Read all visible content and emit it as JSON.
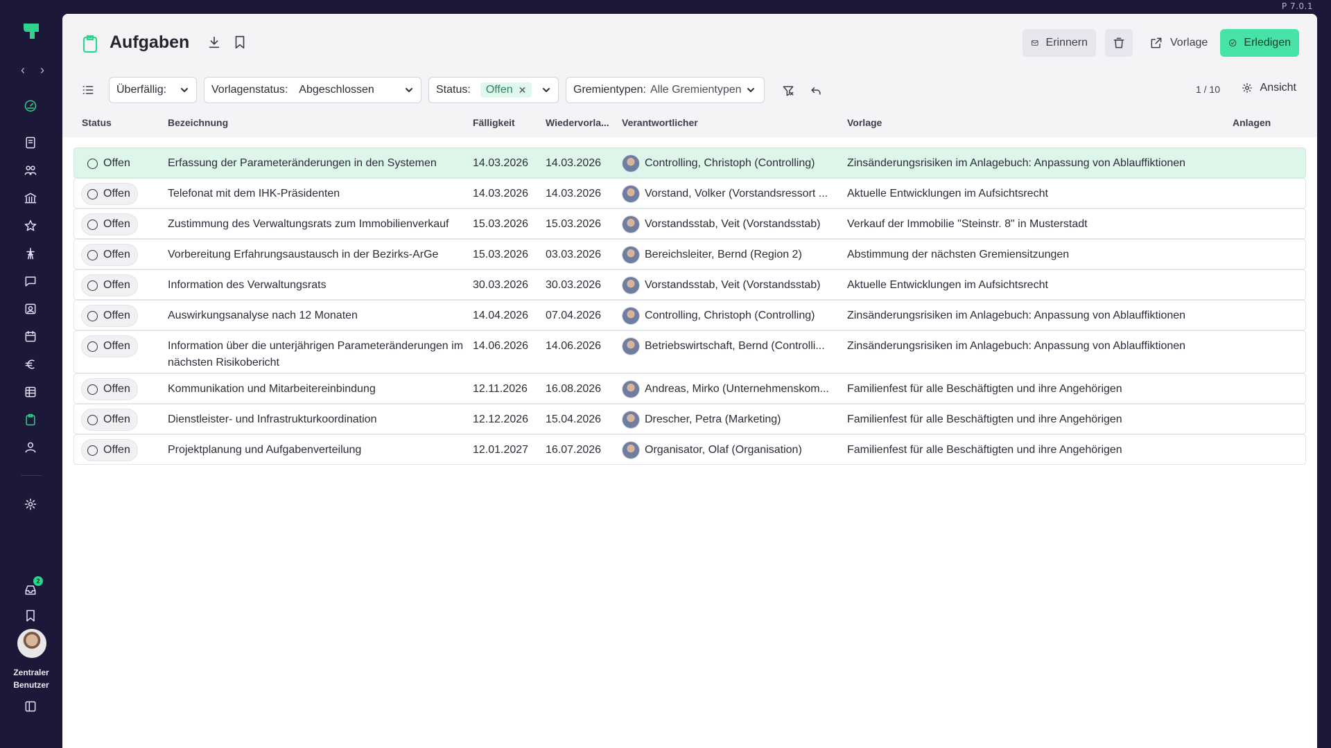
{
  "app": {
    "version": "P 7.0.1",
    "user_name_line1": "Zentraler",
    "user_name_line2": "Benutzer",
    "inbox_badge": "2"
  },
  "header": {
    "title": "Aufgaben",
    "buttons": {
      "remind": "Erinnern",
      "template": "Vorlage",
      "complete": "Erledigen"
    }
  },
  "filters": {
    "overdue_label": "Überfällig:",
    "template_status_label": "Vorlagenstatus:",
    "template_status_value": "Abgeschlossen",
    "status_label": "Status:",
    "status_value": "Offen",
    "committee_label": "Gremientypen:",
    "committee_value": "Alle Gremientypen",
    "pager": "1 / 10",
    "view_label": "Ansicht"
  },
  "columns": {
    "status": "Status",
    "name": "Bezeichnung",
    "due": "Fälligkeit",
    "resubmit": "Wiedervorla...",
    "responsible": "Verantwortlicher",
    "template": "Vorlage",
    "attachments": "Anlagen"
  },
  "rows": [
    {
      "status": "Offen",
      "name": "Erfassung der Parameteränderungen in den Systemen",
      "due": "14.03.2026",
      "resubmit": "14.03.2026",
      "responsible": "Controlling, Christoph (Controlling)",
      "template": "Zinsänderungsrisiken im Anlagebuch: Anpassung von Ablauffiktionen"
    },
    {
      "status": "Offen",
      "name": "Telefonat mit dem IHK-Präsidenten",
      "due": "14.03.2026",
      "resubmit": "14.03.2026",
      "responsible": "Vorstand, Volker (Vorstandsressort ...",
      "template": "Aktuelle Entwicklungen im Aufsichtsrecht"
    },
    {
      "status": "Offen",
      "name": "Zustimmung des Verwaltungsrats zum Immobilienverkauf",
      "due": "15.03.2026",
      "resubmit": "15.03.2026",
      "responsible": "Vorstandsstab, Veit (Vorstandsstab)",
      "template": "Verkauf der Immobilie \"Steinstr. 8\" in Musterstadt"
    },
    {
      "status": "Offen",
      "name": "Vorbereitung Erfahrungsaustausch in der Bezirks-ArGe",
      "due": "15.03.2026",
      "resubmit": "03.03.2026",
      "responsible": "Bereichsleiter, Bernd (Region 2)",
      "template": "Abstimmung der nächsten Gremiensitzungen"
    },
    {
      "status": "Offen",
      "name": "Information des Verwaltungsrats",
      "due": "30.03.2026",
      "resubmit": "30.03.2026",
      "responsible": "Vorstandsstab, Veit (Vorstandsstab)",
      "template": "Aktuelle Entwicklungen im Aufsichtsrecht"
    },
    {
      "status": "Offen",
      "name": "Auswirkungsanalyse nach 12 Monaten",
      "due": "14.04.2026",
      "resubmit": "07.04.2026",
      "responsible": "Controlling, Christoph (Controlling)",
      "template": "Zinsänderungsrisiken im Anlagebuch: Anpassung von Ablauffiktionen"
    },
    {
      "status": "Offen",
      "name": "Information über die unterjährigen Parameteränderungen im nächsten Risikobericht",
      "due": "14.06.2026",
      "resubmit": "14.06.2026",
      "responsible": "Betriebswirtschaft, Bernd (Controlli...",
      "template": "Zinsänderungsrisiken im Anlagebuch: Anpassung von Ablauffiktionen"
    },
    {
      "status": "Offen",
      "name": "Kommunikation und Mitarbeitereinbindung",
      "due": "12.11.2026",
      "resubmit": "16.08.2026",
      "responsible": "Andreas, Mirko (Unternehmenskom...",
      "template": "Familienfest für alle Beschäftigten und ihre Angehörigen"
    },
    {
      "status": "Offen",
      "name": "Dienstleister- und Infrastrukturkoordination",
      "due": "12.12.2026",
      "resubmit": "15.04.2026",
      "responsible": "Drescher, Petra (Marketing)",
      "template": "Familienfest für alle Beschäftigten und ihre Angehörigen"
    },
    {
      "status": "Offen",
      "name": "Projektplanung und Aufgabenverteilung",
      "due": "12.01.2027",
      "resubmit": "16.07.2026",
      "responsible": "Organisator, Olaf (Organisation)",
      "template": "Familienfest für alle Beschäftigten und ihre Angehörigen"
    }
  ],
  "colors": {
    "accent": "#2fd48b",
    "complete_button": "#46e2a6",
    "selected_row": "#def6e9",
    "sidebar_bg": "#1b1838"
  }
}
